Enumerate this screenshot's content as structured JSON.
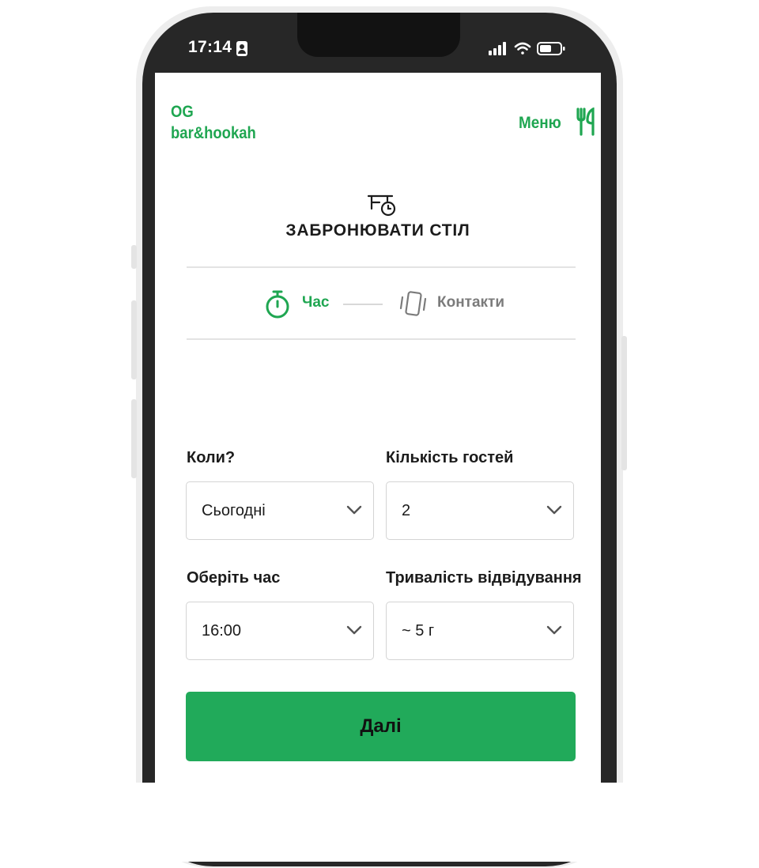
{
  "status_bar": {
    "time": "17:14"
  },
  "header": {
    "logo_line1": "OG",
    "logo_line2": "bar&hookah",
    "menu_label": "Меню"
  },
  "booking": {
    "title": "ЗАБРОНЮВАТИ СТІЛ",
    "steps": [
      {
        "label": "Час",
        "active": true
      },
      {
        "label": "Контакти",
        "active": false
      }
    ]
  },
  "form": {
    "when": {
      "label": "Коли?",
      "value": "Сьогодні"
    },
    "guests": {
      "label": "Кількість гостей",
      "value": "2"
    },
    "time": {
      "label": "Оберіть час",
      "value": "16:00"
    },
    "duration": {
      "label": "Тривалість відвідування",
      "value": "~ 5 г"
    },
    "submit_label": "Далі"
  },
  "colors": {
    "accent": "#1fa651",
    "button": "#21aa5a",
    "inactive": "#7b7b7b"
  }
}
